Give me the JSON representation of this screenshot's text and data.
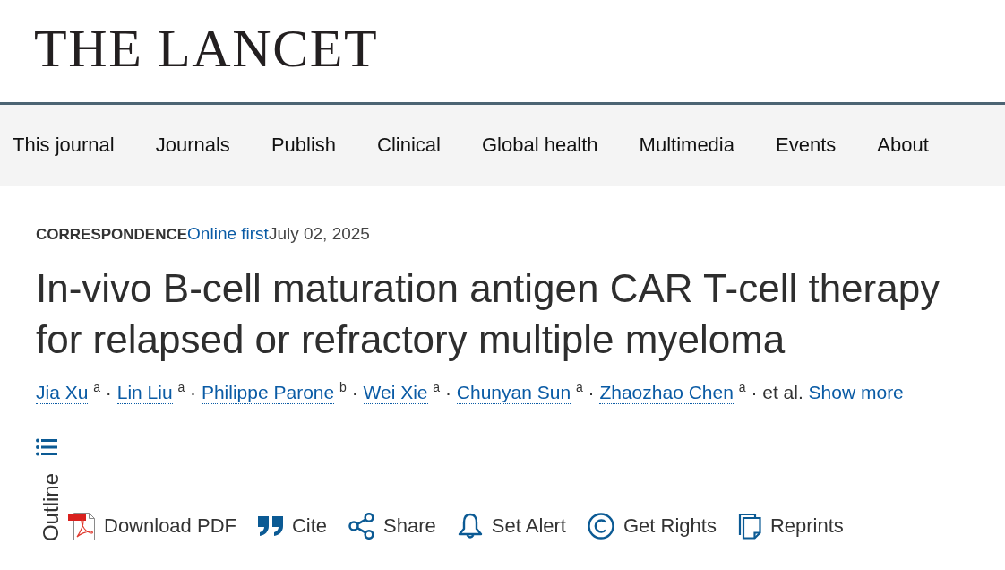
{
  "header": {
    "logo": "THE LANCET"
  },
  "nav": {
    "items": [
      {
        "label": "This journal"
      },
      {
        "label": "Journals"
      },
      {
        "label": "Publish"
      },
      {
        "label": "Clinical"
      },
      {
        "label": "Global health"
      },
      {
        "label": "Multimedia"
      },
      {
        "label": "Events"
      },
      {
        "label": "About"
      }
    ]
  },
  "article": {
    "article_type": "CORRESPONDENCE",
    "status": "Online first",
    "date": "July 02, 2025",
    "title": "In-vivo B-cell maturation antigen CAR T-cell therapy for relapsed or refractory multiple myeloma",
    "authors": [
      {
        "name": "Jia Xu",
        "affiliation": "a",
        "separator": "·"
      },
      {
        "name": "Lin Liu",
        "affiliation": "a",
        "separator": "·"
      },
      {
        "name": "Philippe Parone",
        "affiliation": "b",
        "separator": "·"
      },
      {
        "name": "Wei Xie",
        "affiliation": "a",
        "separator": "·"
      },
      {
        "name": "Chunyan Sun",
        "affiliation": "a",
        "separator": "·"
      },
      {
        "name": "Zhaozhao Chen",
        "affiliation": "a",
        "separator": "·"
      }
    ],
    "et_al": "et al.",
    "show_more": "Show more"
  },
  "outline": {
    "label": "Outline"
  },
  "actions": [
    {
      "kind": "pdf",
      "label": "Download PDF"
    },
    {
      "kind": "cite",
      "label": "Cite"
    },
    {
      "kind": "share",
      "label": "Share"
    },
    {
      "kind": "alert",
      "label": "Set Alert"
    },
    {
      "kind": "rights",
      "label": "Get Rights"
    },
    {
      "kind": "reprints",
      "label": "Reprints"
    }
  ]
}
